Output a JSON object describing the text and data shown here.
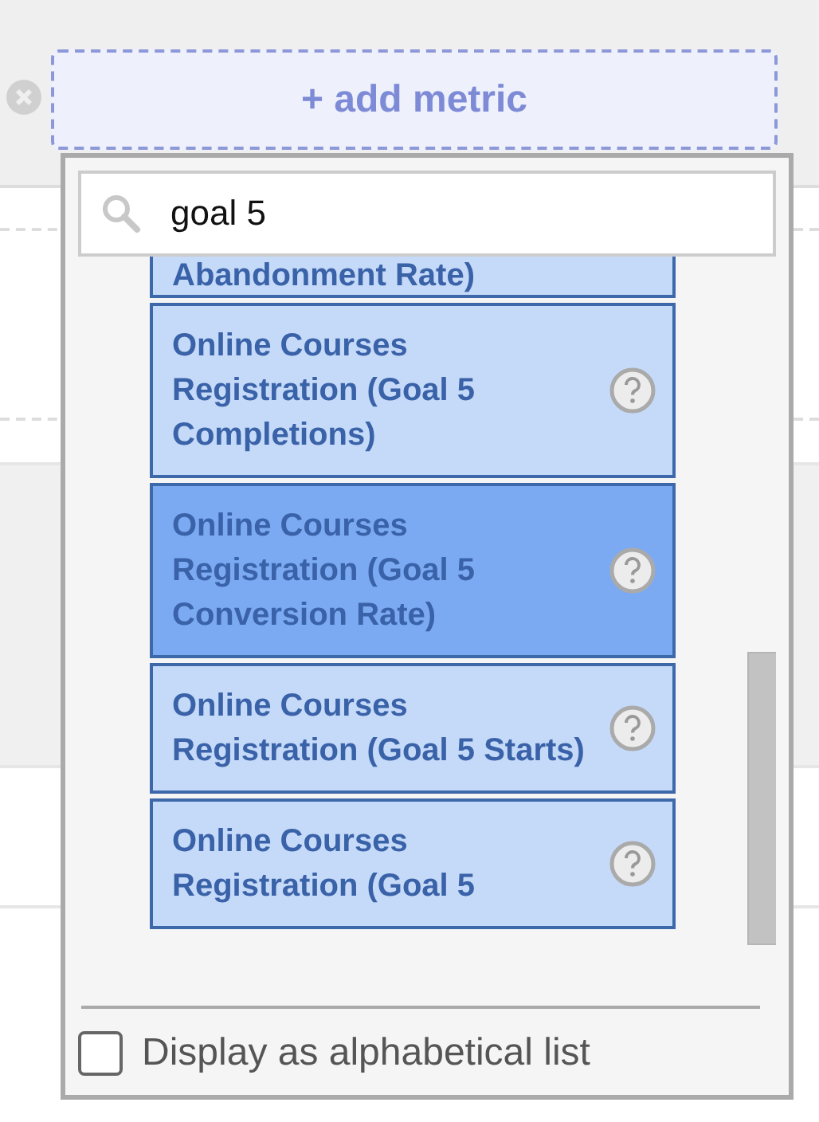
{
  "add_metric_button": {
    "label": "+ add metric"
  },
  "dropdown": {
    "search": {
      "value": "goal 5"
    },
    "items": [
      {
        "label": "Abandonment Rate)",
        "selected": false
      },
      {
        "label": "Online Courses Registration (Goal 5 Completions)",
        "selected": false
      },
      {
        "label": "Online Courses Registration (Goal 5 Conversion Rate)",
        "selected": true
      },
      {
        "label": "Online Courses Registration (Goal 5 Starts)",
        "selected": false
      },
      {
        "label": "Online Courses Registration (Goal 5",
        "selected": false
      }
    ],
    "alphabetical_option": {
      "label": "Display as alphabetical list",
      "checked": false
    }
  }
}
